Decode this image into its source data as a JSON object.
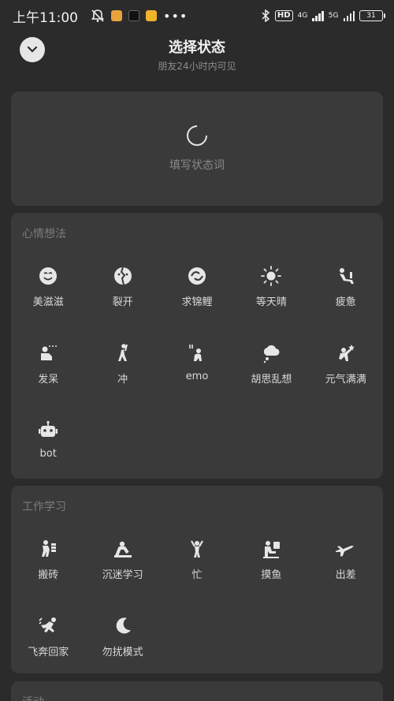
{
  "status_bar": {
    "time": "上午11:00",
    "hd_label": "HD",
    "network_1": "4G",
    "network_2": "5G",
    "battery": "31"
  },
  "header": {
    "title": "选择状态",
    "subtitle": "朋友24小时内可见"
  },
  "custom_status": {
    "placeholder": "填写状态词"
  },
  "mood": {
    "title": "心情想法",
    "items": [
      {
        "label": "美滋滋",
        "icon": "smiley-icon"
      },
      {
        "label": "裂开",
        "icon": "cracked-face-icon"
      },
      {
        "label": "求锦鲤",
        "icon": "koi-icon"
      },
      {
        "label": "等天晴",
        "icon": "sun-icon"
      },
      {
        "label": "疲惫",
        "icon": "tired-person-icon"
      },
      {
        "label": "发呆",
        "icon": "daze-icon"
      },
      {
        "label": "冲",
        "icon": "charge-person-icon"
      },
      {
        "label": "emo",
        "icon": "emo-person-icon"
      },
      {
        "label": "胡思乱想",
        "icon": "thought-cloud-icon"
      },
      {
        "label": "元气满满",
        "icon": "energetic-person-icon"
      },
      {
        "label": "bot",
        "icon": "robot-icon"
      }
    ]
  },
  "work": {
    "title": "工作学习",
    "items": [
      {
        "label": "搬砖",
        "icon": "carry-bricks-icon"
      },
      {
        "label": "沉迷学习",
        "icon": "studying-icon"
      },
      {
        "label": "忙",
        "icon": "busy-person-icon"
      },
      {
        "label": "摸鱼",
        "icon": "slacking-icon"
      },
      {
        "label": "出差",
        "icon": "airplane-icon"
      },
      {
        "label": "飞奔回家",
        "icon": "running-home-icon"
      },
      {
        "label": "勿扰模式",
        "icon": "moon-icon"
      }
    ]
  },
  "activity": {
    "title": "活动"
  }
}
